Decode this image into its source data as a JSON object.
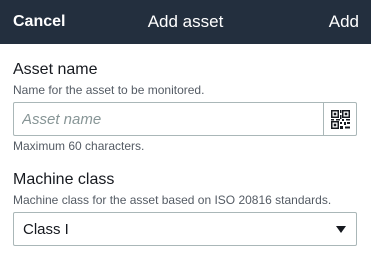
{
  "header": {
    "cancel_label": "Cancel",
    "title": "Add asset",
    "add_label": "Add",
    "background": "#232f3e"
  },
  "asset_name": {
    "label": "Asset name",
    "description": "Name for the asset to be monitored.",
    "placeholder": "Asset name",
    "value": "",
    "help_text": "Maximum 60 characters.",
    "scan_icon": "qr-code-icon"
  },
  "machine_class": {
    "label": "Machine class",
    "description": "Machine class for the asset based on ISO 20816 standards.",
    "selected": "Class I",
    "dropdown_icon": "caret-down-icon"
  }
}
